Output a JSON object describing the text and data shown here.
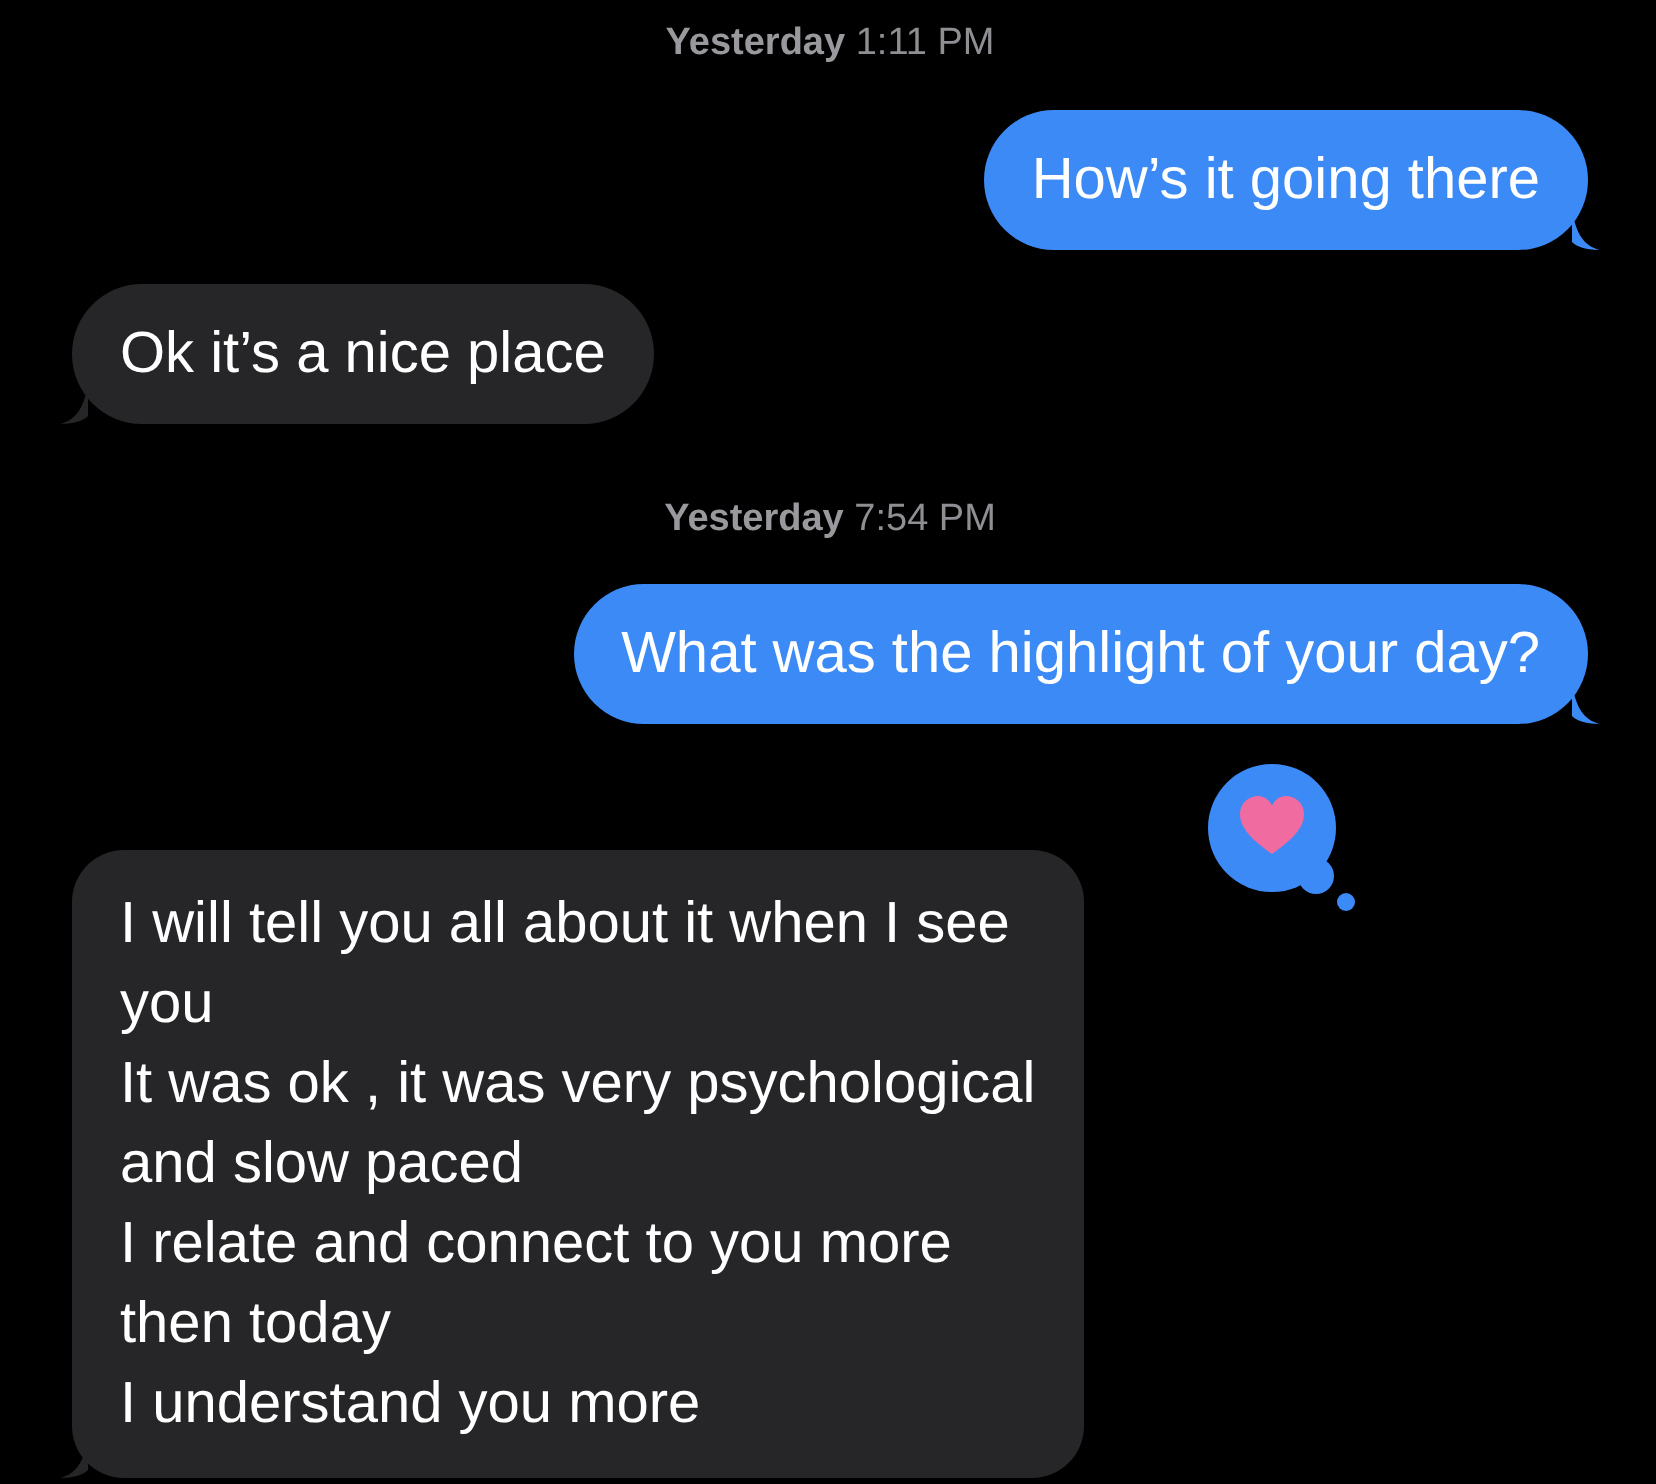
{
  "messages": [
    {
      "kind": "timestamp",
      "text": "**Yesterday** 1:11 PM"
    },
    {
      "kind": "message",
      "from_me": true,
      "text": "How’s it going there"
    },
    {
      "kind": "message",
      "from_me": false,
      "text": "Ok it’s a nice place"
    },
    {
      "kind": "timestamp",
      "text": "**Yesterday** 7:54 PM"
    },
    {
      "kind": "message",
      "from_me": true,
      "text": "What was the highlight of your day?"
    },
    {
      "kind": "message",
      "from_me": false,
      "reacted": true,
      "text": "I will tell you all about it when I see\nyou\nIt was ok , it was very psychological\nand slow paced\nI relate and connect to you more\nthen today\nI understand you more"
    }
  ]
}
